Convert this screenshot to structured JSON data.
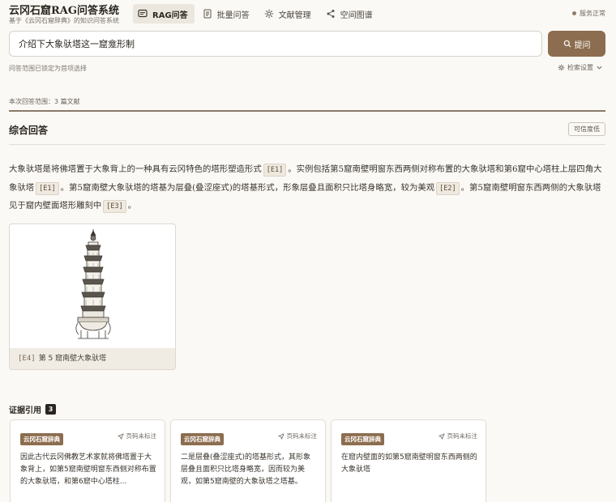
{
  "header": {
    "title": "云冈石窟RAG问答系统",
    "subtitle": "基于《云冈石窟辞典》的知识问答系统",
    "status": "服务正常",
    "tabs": [
      {
        "label": "RAG问答",
        "icon": "chat-icon",
        "active": true
      },
      {
        "label": "批量问答",
        "icon": "document-icon",
        "active": false
      },
      {
        "label": "文献管理",
        "icon": "gear-icon",
        "active": false
      },
      {
        "label": "空间图谱",
        "icon": "share-icon",
        "active": false
      }
    ]
  },
  "search": {
    "value": "介绍下大象驮塔这一窟龛形制",
    "ask_label": "提问"
  },
  "scope_note": "问答范围已锁定为首项选择",
  "settings_label": "检索设置",
  "range_note": "本次回答范围：3 篇文献",
  "answer": {
    "title": "综合回答",
    "confidence": "可信度低",
    "segments": [
      {
        "text": "大象驮塔是将佛塔置于大象背上的一种具有云冈特色的塔形塑造形式"
      },
      {
        "cite": "[E1]"
      },
      {
        "text": "。实例包括第5窟南壁明窗东西两侧对称布置的大象驮塔和第6窟中心塔柱上层四角大象驮塔"
      },
      {
        "cite": "[E1]"
      },
      {
        "text": "。第5窟南壁大象驮塔的塔基为层叠(叠涩座式)的塔基形式，形象层叠且面积只比塔身略宽，较为美观"
      },
      {
        "cite": "[E2]"
      },
      {
        "text": "。第5窟南壁明窗东西两侧的大象驮塔见于窟内壁面塔形雕刻中"
      },
      {
        "cite": "[E3]"
      },
      {
        "text": "。"
      }
    ]
  },
  "image": {
    "code": "[E4]",
    "caption": "第 5 窟南壁大象驮塔"
  },
  "evidence": {
    "title": "证据引用",
    "count": "3",
    "cards": [
      {
        "source": "云冈石窟辞典",
        "page": "页码未标注",
        "text": "因此古代云冈佛教艺术家就将佛塔置于大象背上，如第5窟南壁明窗东西侧对称布置的大象驮塔，和第6窟中心塔柱..."
      },
      {
        "source": "云冈石窟辞典",
        "page": "页码未标注",
        "text": "二是层叠(叠涩座式)的塔基形式，其形象层叠且面积只比塔身略宽，因而较为美观，如第5窟南壁的大象驮塔之塔基。"
      },
      {
        "source": "云冈石窟辞典",
        "page": "页码未标注",
        "text": "在窟内壁面的如第5窟南壁明窗东西两侧的大象驮塔"
      }
    ]
  },
  "colors": {
    "accent": "#8c6d4f",
    "divider": "#8a7b68",
    "background": "#fbf9f5"
  }
}
